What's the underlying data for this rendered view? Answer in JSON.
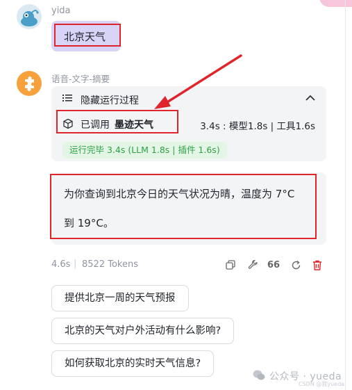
{
  "user": {
    "name": "yida",
    "message": "北京天气"
  },
  "bot": {
    "name": "语音-文字-摘要"
  },
  "process": {
    "header_label": "隐藏运行过程",
    "tool_prefix": "已调用",
    "tool_name": "墨迹天气",
    "tool_stats": "3.4s : 模型1.8s | 工具1.6s",
    "done_badge": "运行完毕 3.4s (LLM 1.8s | 插件 1.6s)"
  },
  "answer": {
    "line1": "为你查询到北京今日的天气状况为晴，温度为 7°C",
    "line2": "到 19°C。"
  },
  "meta": {
    "time": "4.6s",
    "separator": "|",
    "tokens": "8522 Tokens",
    "quote_glyph": "66"
  },
  "suggestions": [
    "提供北京一周的天气预报",
    "北京的天气对户外活动有什么影响?",
    "如何获取北京的实时天气信息?"
  ],
  "watermark": {
    "text": "公众号 · yueda",
    "small": "CSDN @我yueda"
  },
  "colors": {
    "annotation_red": "#e0242b",
    "user_bubble": "#d8d4f8",
    "card_bg": "#f3f4f6",
    "success_green": "#2ea043",
    "delete_red": "#e0242b"
  },
  "icons": {
    "list": "list-icon",
    "collapse": "chevron-up-icon",
    "tool": "cube-icon",
    "copy": "copy-icon",
    "tool_wrench": "wrench-icon",
    "quote": "quote-icon",
    "refresh": "refresh-icon",
    "delete": "trash-icon"
  }
}
